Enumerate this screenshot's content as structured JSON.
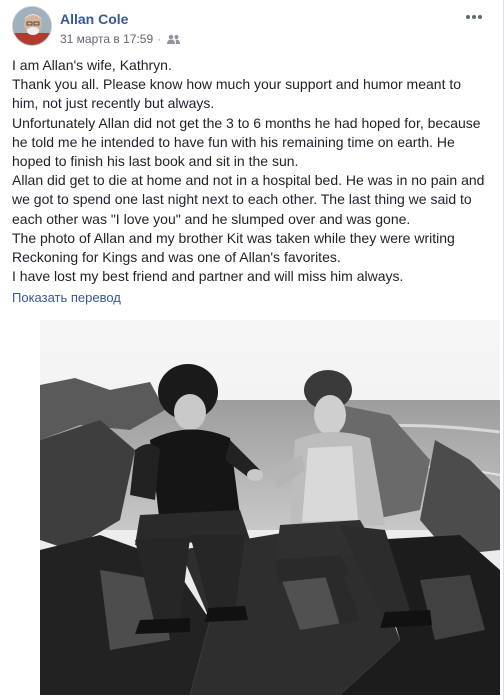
{
  "post": {
    "author": "Allan Cole",
    "timestamp": "31 марта в 17:59",
    "separator": "·",
    "privacy_icon": "friends-icon",
    "more_icon": "ellipsis-icon",
    "paragraphs": [
      "I am Allan's wife, Kathryn.",
      "Thank you all. Please know how much your support and humor meant to him, not just recently but always.",
      "Unfortunately Allan did not get the 3 to 6 months he had hoped for, because he told me he intended to have fun with his remaining time on earth. He hoped to finish his last book and sit in the sun.",
      "Allan did get to die at home and not in a hospital bed. He was in no pain and we got to spend one last night next to each other. The last thing we said to each other was \"I love you\" and he slumped over and was gone.",
      "The photo of Allan and my brother Kit was taken while they were writing Reckoning for Kings and was one of Allan's favorites.",
      "I have lost my best friend and partner and will miss him always."
    ],
    "translate_link": "Показать перевод"
  },
  "colors": {
    "link": "#365899",
    "text": "#1d2129",
    "meta": "#616770"
  }
}
